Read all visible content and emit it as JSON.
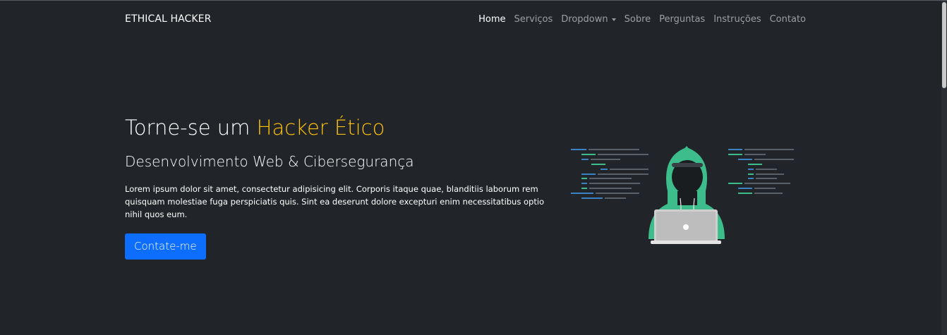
{
  "navbar": {
    "brand": "ETHICAL HACKER",
    "links": [
      {
        "label": "Home",
        "active": true
      },
      {
        "label": "Serviços",
        "active": false
      },
      {
        "label": "Dropdown",
        "active": false
      },
      {
        "label": "Sobre",
        "active": false
      },
      {
        "label": "Perguntas",
        "active": false
      },
      {
        "label": "Instruções",
        "active": false
      },
      {
        "label": "Contato",
        "active": false
      }
    ]
  },
  "hero": {
    "title_prefix": "Torne-se um ",
    "title_accent": "Hacker Ético",
    "subtitle": "Desenvolvimento Web & Cibersegurança",
    "body": "Lorem ipsum dolor sit amet, consectetur adipisicing elit. Corporis itaque quae, blanditiis laborum rem quisquam molestiae fuga perspiciatis quis. Sint ea deserunt dolore excepturi enim necessitatibus optio nihil quos eum.",
    "cta_label": "Contate-me"
  },
  "illustration": {
    "icon": "hooded-hacker-with-laptop"
  },
  "colors": {
    "background": "#212529",
    "accent": "#ffc107",
    "primary_button": "#0d6efd",
    "hood": "#3dbd8b",
    "code_blue": "#3b82c4",
    "code_green": "#3dbd8b",
    "code_gray": "#5a6068"
  }
}
